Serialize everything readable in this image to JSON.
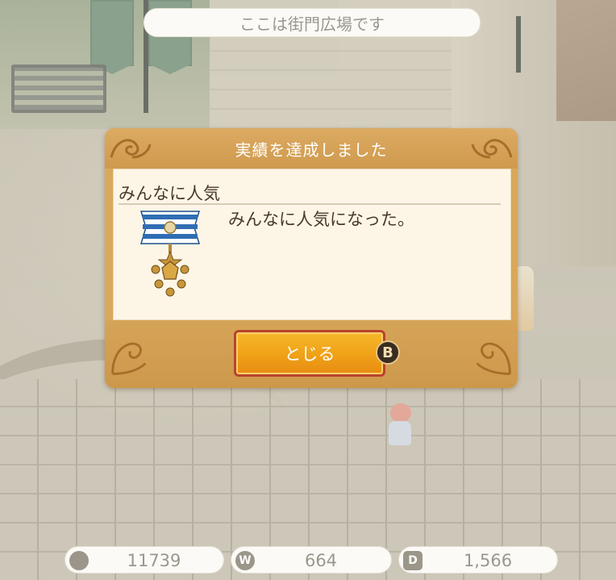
{
  "location": {
    "text": "ここは街門広場です"
  },
  "dialog": {
    "title": "実績を達成しました",
    "achievement_name": "みんなに人気",
    "achievement_desc": "みんなに人気になった。",
    "close_label": "とじる",
    "close_button_hint": "B"
  },
  "currencies": [
    {
      "icon": "coin-icon",
      "value": "11739"
    },
    {
      "icon": "w-token-icon",
      "value": "664",
      "glyph": "W"
    },
    {
      "icon": "d-ticket-icon",
      "value": "1,566",
      "glyph": "D"
    }
  ],
  "colors": {
    "dialog_frame": "#d9a85c",
    "dialog_body": "#fdf6e7",
    "button_orange": "#f0a318",
    "button_border": "#b8432d",
    "medal_ribbon_blue": "#2f6eb3"
  }
}
